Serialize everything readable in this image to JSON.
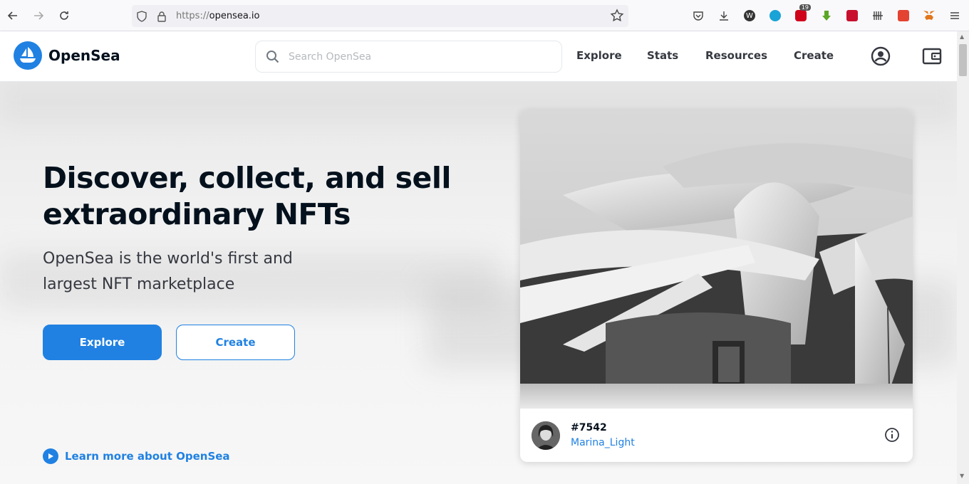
{
  "browser": {
    "url_prefix": "https://",
    "url_host": "opensea.io",
    "ext_badge": "19"
  },
  "header": {
    "logo_text": "OpenSea",
    "search_placeholder": "Search OpenSea",
    "nav": [
      "Explore",
      "Stats",
      "Resources",
      "Create"
    ]
  },
  "hero": {
    "title": "Discover, collect, and sell extraordinary NFTs",
    "subtitle": "OpenSea is the world's first and largest NFT marketplace",
    "explore_label": "Explore",
    "create_label": "Create",
    "learn_more": "Learn more about OpenSea"
  },
  "card": {
    "nft_id": "#7542",
    "owner": "Marina_Light"
  },
  "colors": {
    "accent": "#2081e2",
    "text": "#04111d"
  }
}
